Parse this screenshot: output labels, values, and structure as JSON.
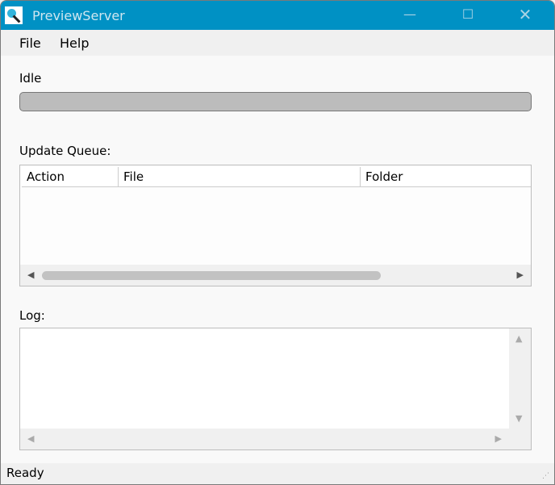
{
  "window": {
    "title": "PreviewServer"
  },
  "menu": [
    "File",
    "Help"
  ],
  "progress": {
    "label": "Idle",
    "value": 0
  },
  "queue": {
    "label": "Update Queue:",
    "columns": [
      "Action",
      "File",
      "Folder"
    ],
    "rows": []
  },
  "log": {
    "label": "Log:",
    "text": ""
  },
  "status": "Ready"
}
